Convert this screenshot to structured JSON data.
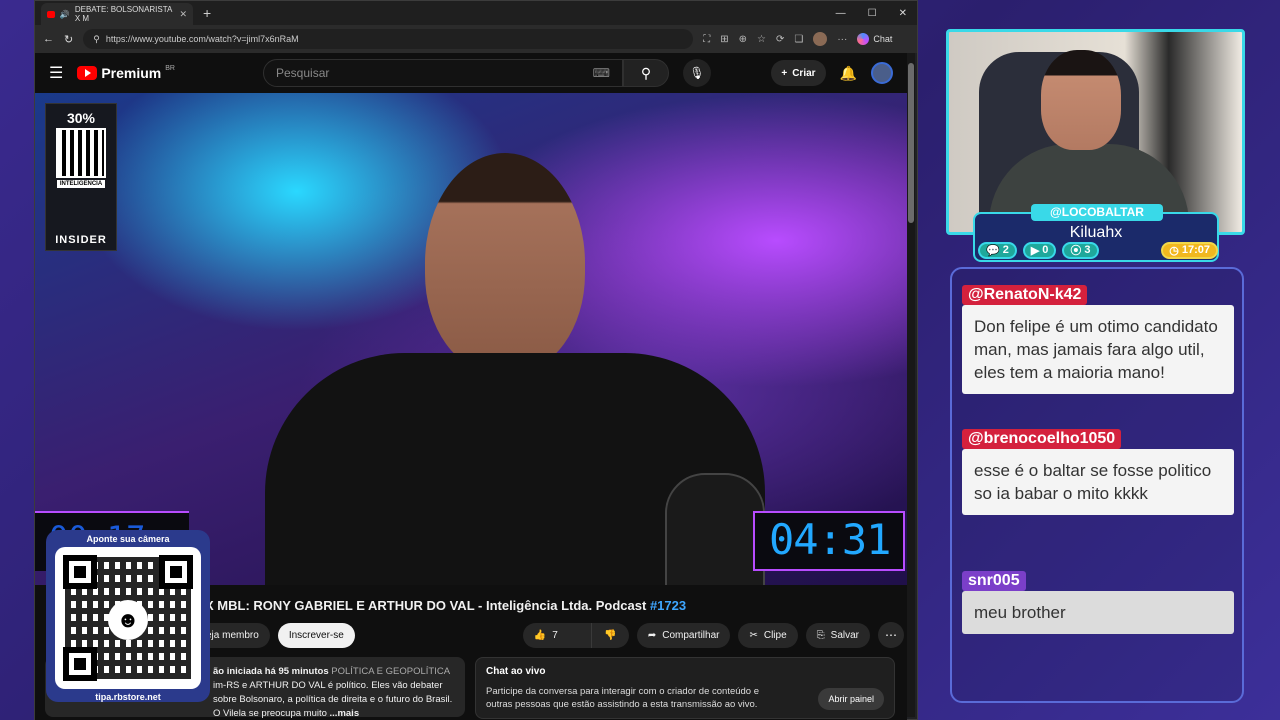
{
  "browser": {
    "tab_title": "DEBATE: BOLSONARISTA X M",
    "url": "https://www.youtube.com/watch?v=jiml7x6nRaM",
    "chat_label": "Chat"
  },
  "youtube": {
    "logo": "Premium",
    "region": "BR",
    "search_placeholder": "Pesquisar",
    "create_label": "Criar"
  },
  "video": {
    "ad_discount": "30%",
    "ad_label": "INTELIGENCIA",
    "ad_brand": "INSIDER",
    "timer_left": "00:17",
    "timer_right": "04:31"
  },
  "info": {
    "title": "X MBL: RONY GABRIEL E ARTHUR DO VAL - Inteligência Ltda. Podcast",
    "episode_tag": "#1723",
    "member_label": "eja membro",
    "subscribe_label": "Inscrever-se",
    "like_count": "7",
    "share_label": "Compartilhar",
    "clip_label": "Clipe",
    "save_label": "Salvar",
    "desc_status": "ão iniciada há 95 minutos",
    "desc_tags": "POLÍTICA E GEOPOLÍTICA",
    "desc_line2": "im-RS e ARTHUR DO VAL é político. Eles vão debater",
    "desc_line3": "sobre Bolsonaro, a política de direita e o futuro do Brasil. O Vilela se preocupa muito",
    "desc_more": "...mais",
    "chat_title": "Chat ao vivo",
    "chat_text": "Participe da conversa para interagir com o criador de conteúdo e outras pessoas que estão assistindo a esta transmissão ao vivo.",
    "chat_open": "Abrir painel"
  },
  "qr_overlay": {
    "top_text": "Aponte sua câmera",
    "bottom_text": "tipa.rbstore.net"
  },
  "streamer": {
    "handle": "@LOCOBALTAR",
    "name": "Kiluahx",
    "stat_chat": "2",
    "stat_video": "0",
    "stat_other": "3",
    "time": "17:07"
  },
  "chat_messages": [
    {
      "user": "@RenatoN-k42",
      "text": "Don felipe é um otimo candidato man, mas jamais fara algo util, eles tem a maioria mano!",
      "color": "#d4213d"
    },
    {
      "user": "@brenocoelho1050",
      "text": "esse é o baltar se fosse politico so ia babar o mito kkkk",
      "color": "#d4213d"
    },
    {
      "user": "snr005",
      "text": "meu brother",
      "color": "#7b3fc9"
    }
  ]
}
